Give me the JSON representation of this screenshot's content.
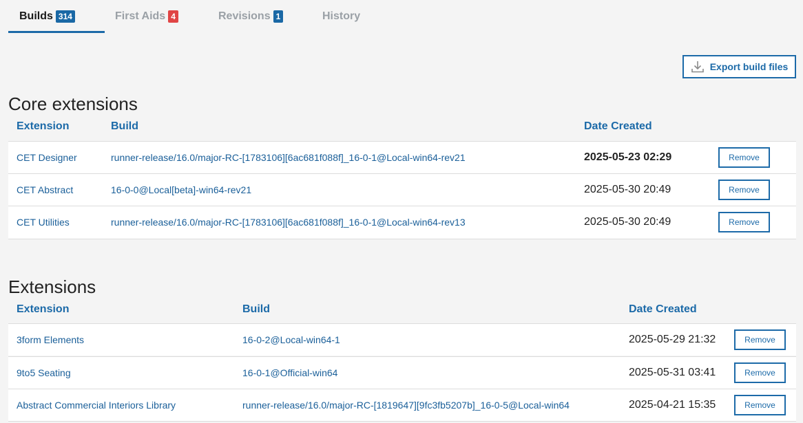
{
  "tabs": [
    {
      "label": "Builds",
      "badge": "314",
      "badge_color": "#1a68a5",
      "active": true
    },
    {
      "label": "First Aids",
      "badge": "4",
      "badge_color": "#e04545",
      "active": false
    },
    {
      "label": "Revisions",
      "badge": "1",
      "badge_color": "#1a68a5",
      "active": false
    },
    {
      "label": "History",
      "active": false
    }
  ],
  "toolbar": {
    "export_label": "Export build files",
    "export_icon": "download-icon"
  },
  "core": {
    "title": "Core extensions",
    "headers": {
      "extension": "Extension",
      "build": "Build",
      "date": "Date Created"
    },
    "rows": [
      {
        "extension": "CET Designer",
        "build": "runner-release/16.0/major-RC-[1783106][6ac681f088f]_16-0-1@Local-win64-rev21",
        "date": "2025-05-23 02:29",
        "action": "Remove"
      },
      {
        "extension": "CET Abstract",
        "build": "16-0-0@Local[beta]-win64-rev21",
        "date": "2025-05-30 20:49",
        "action": "Remove"
      },
      {
        "extension": "CET Utilities",
        "build": "runner-release/16.0/major-RC-[1783106][6ac681f088f]_16-0-1@Local-win64-rev13",
        "date": "2025-05-30 20:49",
        "action": "Remove"
      }
    ]
  },
  "extensions": {
    "title": "Extensions",
    "headers": {
      "extension": "Extension",
      "build": "Build",
      "date": "Date Created"
    },
    "rows": [
      {
        "extension": "3form Elements",
        "build": "16-0-2@Local-win64-1",
        "date": "2025-05-29 21:32",
        "action": "Remove"
      },
      {
        "extension": "9to5 Seating",
        "build": "16-0-1@Official-win64",
        "date": "2025-05-31 03:41",
        "action": "Remove"
      },
      {
        "extension": "Abstract Commercial Interiors Library",
        "build": "runner-release/16.0/major-RC-[1819647][9fc3fb5207b]_16-0-5@Local-win64",
        "date": "2025-04-21 15:35",
        "action": "Remove"
      }
    ]
  },
  "colors": {
    "accent": "#1c6aa8",
    "link": "#1a5f99",
    "alert": "#e04545"
  }
}
